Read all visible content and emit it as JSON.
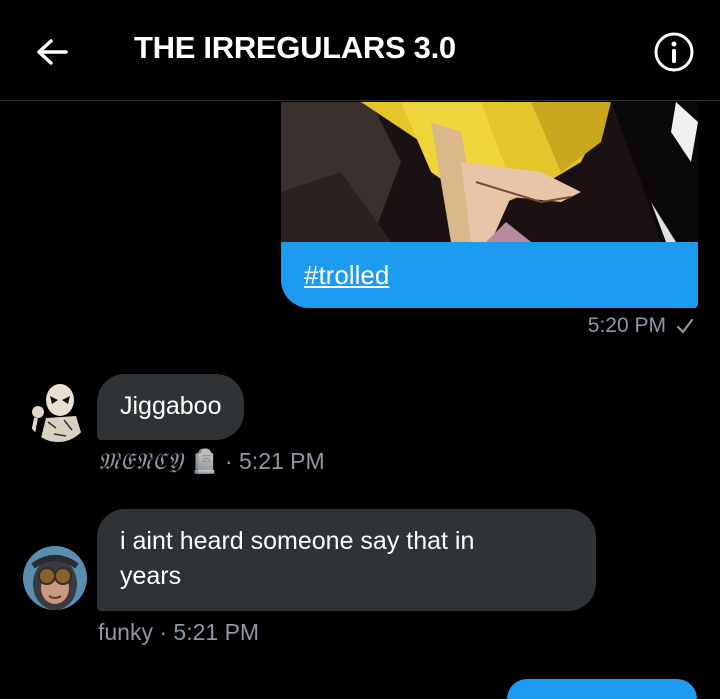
{
  "header": {
    "title": "THE IRREGULARS 3.0",
    "back_icon": "arrow-left-icon",
    "info_icon": "info-icon"
  },
  "messages": [
    {
      "direction": "sent",
      "has_image": true,
      "text": "#trolled",
      "time": "5:20 PM",
      "status_icon": "checkmark-icon"
    },
    {
      "direction": "received",
      "text": "Jiggaboo",
      "sender": "𝔐𝔈𝔑ℭ𝔜",
      "sender_emoji": "🪦",
      "time": "· 5:21 PM"
    },
    {
      "direction": "received",
      "text": "i aint heard someone say that in years",
      "sender": "funky",
      "time": "· 5:21 PM"
    }
  ],
  "colors": {
    "background": "#000000",
    "sent_bubble": "#1d9bf0",
    "received_bubble": "#2f3336",
    "muted_text": "#8b98a5"
  }
}
